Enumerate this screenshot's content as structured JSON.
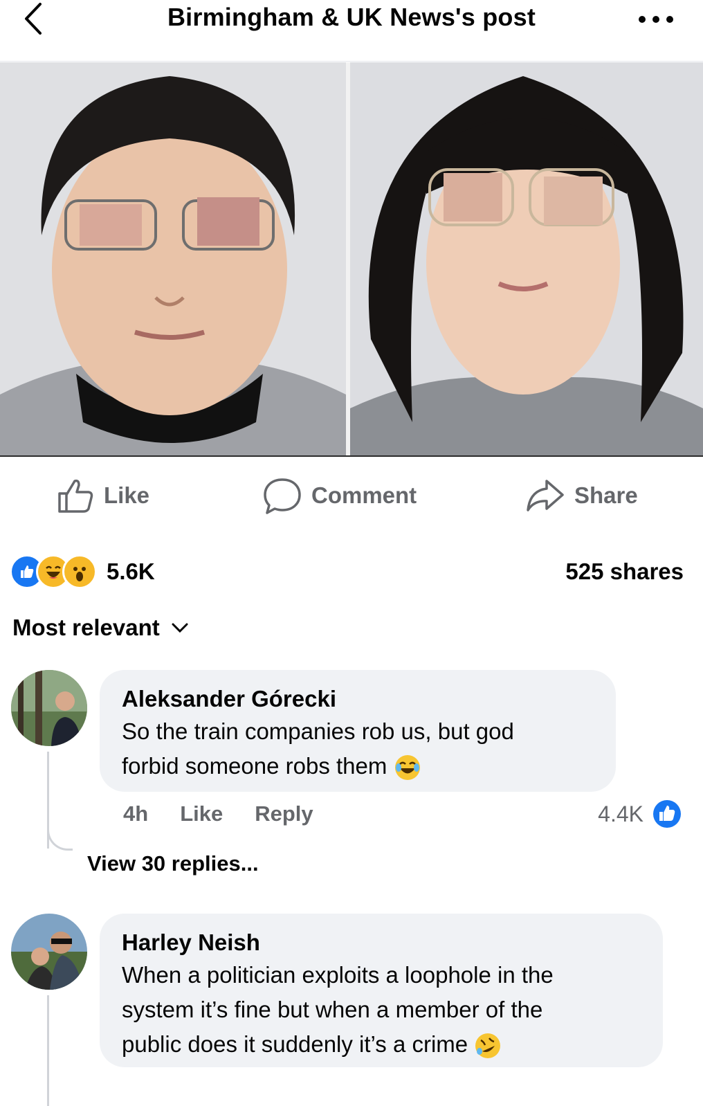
{
  "header": {
    "title": "Birmingham & UK News's post"
  },
  "actions": {
    "like": "Like",
    "comment": "Comment",
    "share": "Share"
  },
  "stats": {
    "reaction_count": "5.6K",
    "shares": "525 shares",
    "reaction_types": [
      "like",
      "haha",
      "wow"
    ]
  },
  "sort": {
    "label": "Most relevant"
  },
  "comments": [
    {
      "author": "Aleksander Górecki",
      "line1": "So the train companies rob us, but god",
      "line2": "forbid someone robs them",
      "emoji": "😂",
      "time": "4h",
      "like_label": "Like",
      "reply_label": "Reply",
      "likes": "4.4K",
      "view_replies": "View 30 replies..."
    },
    {
      "author": "Harley Neish",
      "line1": "When a politician exploits a loophole in the",
      "line2": "system it’s fine but when a member of the",
      "line3": "public does it suddenly it’s a crime",
      "emoji": "🤣"
    }
  ],
  "colors": {
    "accent": "#1877f2",
    "muted": "#65676b",
    "bubble": "#f0f2f5"
  }
}
